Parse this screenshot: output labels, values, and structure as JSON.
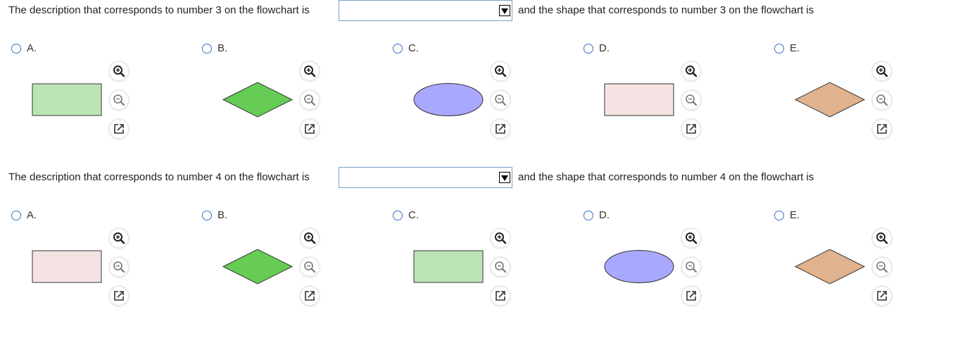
{
  "questions": [
    {
      "prefix": "The description that corresponds to number 3 on the flowchart is",
      "selected": "",
      "suffix": "and the shape that corresponds to number 3 on the flowchart is",
      "options": [
        {
          "label": "A.",
          "shape": "rectangle",
          "fill": "#bce5b6"
        },
        {
          "label": "B.",
          "shape": "diamond",
          "fill": "#66cc55"
        },
        {
          "label": "C.",
          "shape": "ellipse",
          "fill": "#a8a8ff"
        },
        {
          "label": "D.",
          "shape": "rectangle",
          "fill": "#f5e3e3"
        },
        {
          "label": "E.",
          "shape": "diamond",
          "fill": "#e0b38e"
        }
      ]
    },
    {
      "prefix": "The description that corresponds to number 4 on the flowchart is",
      "selected": "",
      "suffix": "and the shape that corresponds to number 4 on the flowchart is",
      "options": [
        {
          "label": "A.",
          "shape": "rectangle",
          "fill": "#f5e3e3"
        },
        {
          "label": "B.",
          "shape": "diamond",
          "fill": "#66cc55"
        },
        {
          "label": "C.",
          "shape": "rectangle",
          "fill": "#bce5b6"
        },
        {
          "label": "D.",
          "shape": "ellipse",
          "fill": "#a8a8ff"
        },
        {
          "label": "E.",
          "shape": "diamond",
          "fill": "#e0b38e"
        }
      ]
    }
  ],
  "tools": [
    "zoom-in-icon",
    "zoom-out-icon",
    "popout-icon"
  ],
  "colors": {
    "radio_border": "#3a6fc4",
    "select_border": "#7a9fd0"
  }
}
